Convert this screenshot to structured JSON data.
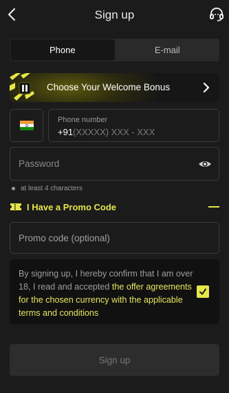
{
  "header": {
    "title": "Sign up"
  },
  "tabs": [
    {
      "label": "Phone",
      "active": true
    },
    {
      "label": "E-mail",
      "active": false
    }
  ],
  "bonus": {
    "label": "Choose Your Welcome Bonus"
  },
  "phone": {
    "label": "Phone number",
    "code": "+91",
    "mask": "(XXXXX) XXX - XXX",
    "country_flag": "india-flag-icon"
  },
  "password": {
    "placeholder": "Password",
    "hint": "at least 4 characters"
  },
  "promo": {
    "toggle_label": "I Have a Promo Code",
    "placeholder": "Promo code (optional)"
  },
  "consent": {
    "text_prefix": "By signing up, I hereby confirm that I am over 18, I read and accepted ",
    "link_text": "the offer agreements for the chosen currency with the applicable terms and conditions",
    "checked": true
  },
  "submit": {
    "label": "Sign up"
  },
  "colors": {
    "accent": "#e6e64a",
    "background": "#1b1b1c"
  }
}
